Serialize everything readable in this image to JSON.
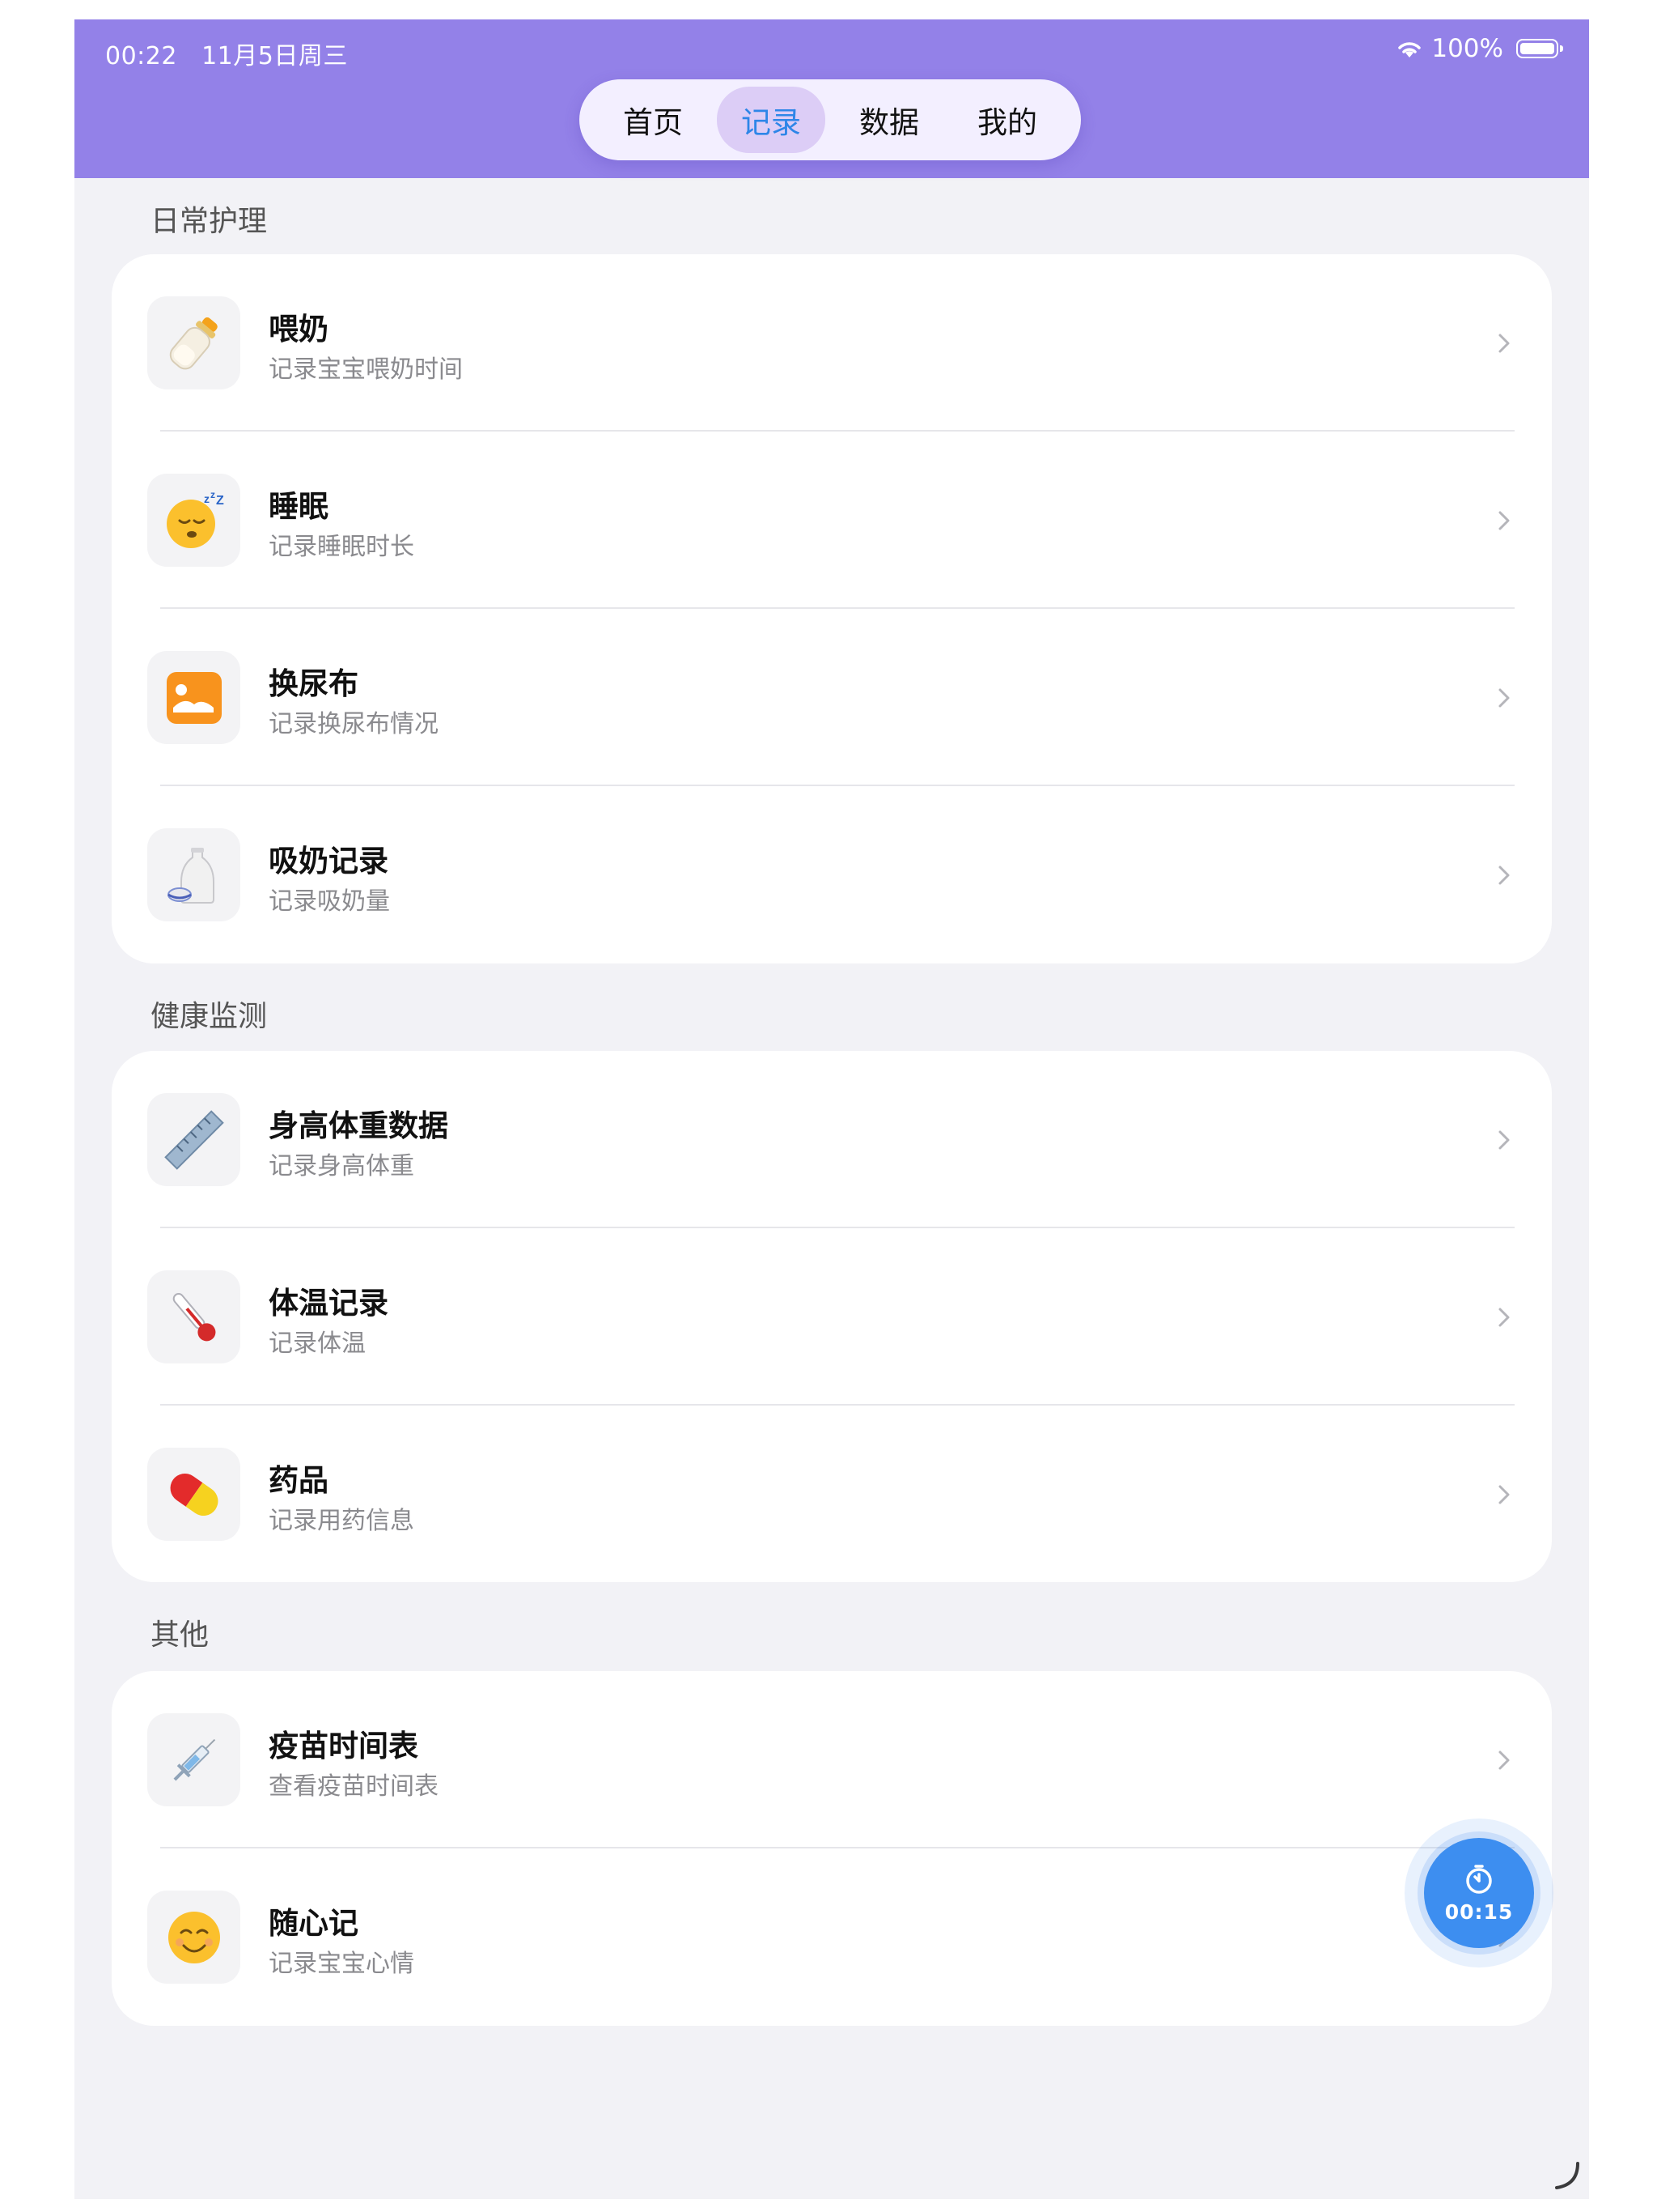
{
  "status_bar": {
    "time": "00:22",
    "date": "11月5日周三",
    "battery": "100%"
  },
  "tabs": [
    {
      "label": "首页",
      "active": false
    },
    {
      "label": "记录",
      "active": true
    },
    {
      "label": "数据",
      "active": false
    },
    {
      "label": "我的",
      "active": false
    }
  ],
  "sections": [
    {
      "title": "日常护理",
      "items": [
        {
          "icon": "baby-bottle-icon",
          "title": "喂奶",
          "subtitle": "记录宝宝喂奶时间"
        },
        {
          "icon": "sleepy-face-icon",
          "title": "睡眠",
          "subtitle": "记录睡眠时长"
        },
        {
          "icon": "diaper-icon",
          "title": "换尿布",
          "subtitle": "记录换尿布情况"
        },
        {
          "icon": "sake-bottle-icon",
          "title": "吸奶记录",
          "subtitle": "记录吸奶量"
        }
      ]
    },
    {
      "title": "健康监测",
      "items": [
        {
          "icon": "ruler-icon",
          "title": "身高体重数据",
          "subtitle": "记录身高体重"
        },
        {
          "icon": "thermometer-icon",
          "title": "体温记录",
          "subtitle": "记录体温"
        },
        {
          "icon": "pill-icon",
          "title": "药品",
          "subtitle": "记录用药信息"
        }
      ]
    },
    {
      "title": "其他",
      "items": [
        {
          "icon": "syringe-icon",
          "title": "疫苗时间表",
          "subtitle": "查看疫苗时间表"
        },
        {
          "icon": "smiling-face-icon",
          "title": "随心记",
          "subtitle": "记录宝宝心情"
        }
      ]
    }
  ],
  "timer": {
    "label": "00:15",
    "icon": "timer-icon"
  },
  "colors": {
    "header": "#9381e8",
    "accent": "#2e86e8",
    "fab": "#3d8ef0",
    "background": "#f2f2f6"
  }
}
